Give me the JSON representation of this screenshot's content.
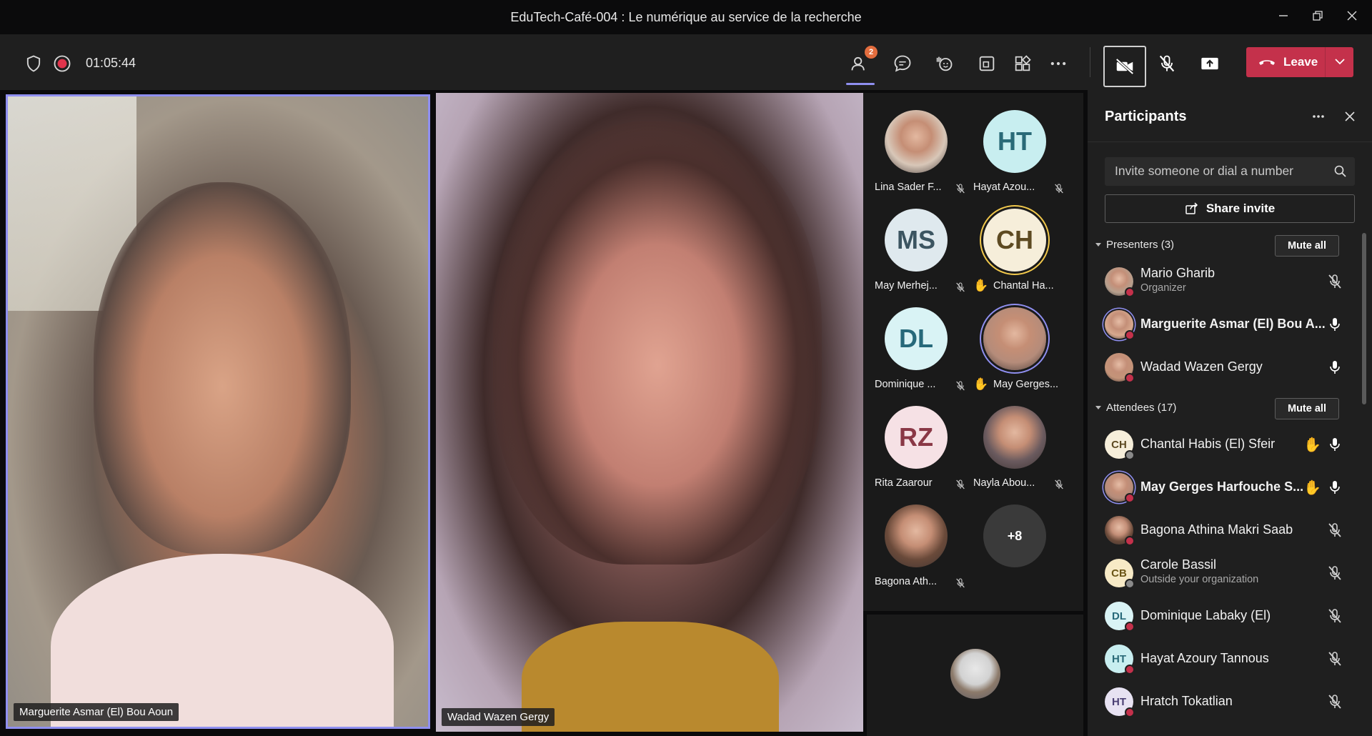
{
  "window": {
    "title": "EduTech-Café-004 : Le numérique au service de la recherche",
    "minimize_icon": "minimize-icon",
    "restore_icon": "restore-icon",
    "close_icon": "close-icon"
  },
  "toolbar": {
    "timer": "01:05:44",
    "participants_badge": "2",
    "leave_label": "Leave"
  },
  "stage": {
    "left_name": "Marguerite Asmar (El) Bou Aoun",
    "right_name": "Wadad Wazen Gergy"
  },
  "gallery": [
    {
      "initials": "",
      "name": "Lina Sader F...",
      "hand": "",
      "kind": "photo",
      "bg": "#d8c7b8"
    },
    {
      "initials": "HT",
      "name": "Hayat Azou...",
      "hand": "",
      "kind": "initials",
      "bg": "#c8eef0",
      "fg": "#2a6a78"
    },
    {
      "initials": "MS",
      "name": "May Merhej...",
      "hand": "",
      "kind": "initials",
      "bg": "#dfe9ee",
      "fg": "#3c5561"
    },
    {
      "initials": "CH",
      "name": "Chantal Ha...",
      "hand": "✋",
      "kind": "initials",
      "bg": "#f6eeda",
      "fg": "#5d4a22"
    },
    {
      "initials": "DL",
      "name": "Dominique ...",
      "hand": "",
      "kind": "initials",
      "bg": "#d9f3f5",
      "fg": "#27697a"
    },
    {
      "initials": "",
      "name": "May Gerges...",
      "hand": "✋",
      "kind": "photo",
      "bg": "#b58c7a"
    },
    {
      "initials": "RZ",
      "name": "Rita Zaarour",
      "hand": "",
      "kind": "initials",
      "bg": "#f6e1e5",
      "fg": "#8a3846"
    },
    {
      "initials": "",
      "name": "Nayla Abou...",
      "hand": "",
      "kind": "photo",
      "bg": "#6a5a5e"
    },
    {
      "initials": "",
      "name": "Bagona Ath...",
      "hand": "",
      "kind": "photo",
      "bg": "#6a4a3a"
    },
    {
      "initials": "+8",
      "name": "",
      "hand": "",
      "kind": "more",
      "bg": "#3a3a3a",
      "fg": "#ffffff"
    }
  ],
  "panel": {
    "title": "Participants",
    "invite_placeholder": "Invite someone or dial a number",
    "share_label": "Share invite",
    "presenters_label": "Presenters (3)",
    "attendees_label": "Attendees (17)",
    "mute_all": "Mute all",
    "presenters": [
      {
        "initials": "",
        "name": "Mario Gharib",
        "sub": "Organizer",
        "bold": false,
        "mic": "off",
        "hand": "",
        "bg": "#b6a08e",
        "fg": "#333",
        "dot": "#c4314b"
      },
      {
        "initials": "",
        "name": "Marguerite Asmar (El) Bou A...",
        "sub": "",
        "bold": true,
        "mic": "on",
        "hand": "",
        "bg": "#d8a98e",
        "fg": "#333",
        "dot": "#c4314b"
      },
      {
        "initials": "",
        "name": "Wadad Wazen Gergy",
        "sub": "",
        "bold": false,
        "mic": "on",
        "hand": "",
        "bg": "#c49479",
        "fg": "#333",
        "dot": "#c4314b"
      }
    ],
    "attendees": [
      {
        "initials": "CH",
        "name": "Chantal Habis (El) Sfeir",
        "sub": "",
        "bold": false,
        "mic": "on",
        "hand": "✋",
        "bg": "#f6eeda",
        "fg": "#5d4a22",
        "dot": "#8a8a8a"
      },
      {
        "initials": "",
        "name": "May Gerges Harfouche S...",
        "sub": "",
        "bold": true,
        "mic": "on",
        "hand": "✋",
        "bg": "#b58c7a",
        "fg": "#333",
        "dot": "#c4314b"
      },
      {
        "initials": "",
        "name": "Bagona Athina Makri Saab",
        "sub": "",
        "bold": false,
        "mic": "off",
        "hand": "",
        "bg": "#6a4a3a",
        "fg": "#333",
        "dot": "#c4314b"
      },
      {
        "initials": "CB",
        "name": "Carole Bassil",
        "sub": "Outside your organization",
        "bold": false,
        "mic": "off",
        "hand": "",
        "bg": "#f7eac6",
        "fg": "#6b5516",
        "dot": "#8a8a8a"
      },
      {
        "initials": "DL",
        "name": "Dominique Labaky (El)",
        "sub": "",
        "bold": false,
        "mic": "off",
        "hand": "",
        "bg": "#d9f3f5",
        "fg": "#27697a",
        "dot": "#c4314b"
      },
      {
        "initials": "HT",
        "name": "Hayat Azoury Tannous",
        "sub": "",
        "bold": false,
        "mic": "off",
        "hand": "",
        "bg": "#c8eef0",
        "fg": "#2a6a78",
        "dot": "#c4314b"
      },
      {
        "initials": "HT",
        "name": "Hratch Tokatlian",
        "sub": "",
        "bold": false,
        "mic": "off",
        "hand": "",
        "bg": "#e7e2f2",
        "fg": "#4a3f73",
        "dot": "#c4314b"
      }
    ]
  },
  "colors": {
    "accent": "#8f8ff0",
    "leave": "#c4314b",
    "badge": "#e36d3e"
  }
}
